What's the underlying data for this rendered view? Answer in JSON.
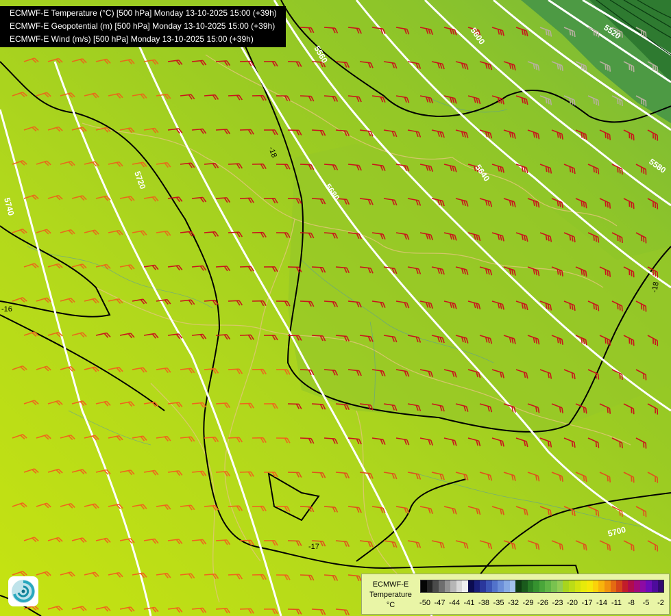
{
  "titles": [
    "ECMWF-E Temperature (°C) [500 hPa] Monday 13-10-2025 15:00 (+39h)",
    "ECMWF-E Geopotential (m) [500 hPa] Monday 13-10-2025 15:00 (+39h)",
    "ECMWF-E Wind (m/s) [500 hPa] Monday 13-10-2025 15:00 (+39h)"
  ],
  "geopotential_labels": [
    "5520",
    "5560",
    "5580",
    "5600",
    "5640",
    "5680",
    "5700",
    "5720",
    "5740"
  ],
  "temperature_labels": [
    "-18",
    "-16",
    "-17",
    "-18"
  ],
  "legend": {
    "title_line1": "ECMWF-E",
    "title_line2": "Temperature",
    "unit": "°C",
    "ticks": [
      "-50",
      "-47",
      "-44",
      "-41",
      "-38",
      "-35",
      "-32",
      "-29",
      "-26",
      "-23",
      "-20",
      "-17",
      "-14",
      "-11",
      "-8",
      "-5",
      "-2"
    ],
    "colors": [
      "#050505",
      "#252525",
      "#4a4a4a",
      "#6e6e6e",
      "#929292",
      "#b6b6b6",
      "#d8d8d8",
      "#f0f0f0",
      "#0c0c50",
      "#1a1f7a",
      "#2a379c",
      "#3c55b6",
      "#5272ca",
      "#6b8ed8",
      "#86a9e3",
      "#a2c2ec",
      "#0f3d12",
      "#1a5b1c",
      "#277a26",
      "#35922f",
      "#4aa63a",
      "#60b545",
      "#79c24f",
      "#92cc55",
      "#a8d51d",
      "#bcdc16",
      "#d2e30f",
      "#e7ea0a",
      "#f5e80a",
      "#fbd20a",
      "#f8b40c",
      "#f0920f",
      "#e46a12",
      "#d4441a",
      "#c21d2a",
      "#b00c4c",
      "#a2097a",
      "#8d0aa4",
      "#6d0bb8",
      "#4d0b9c",
      "#330a70"
    ]
  }
}
